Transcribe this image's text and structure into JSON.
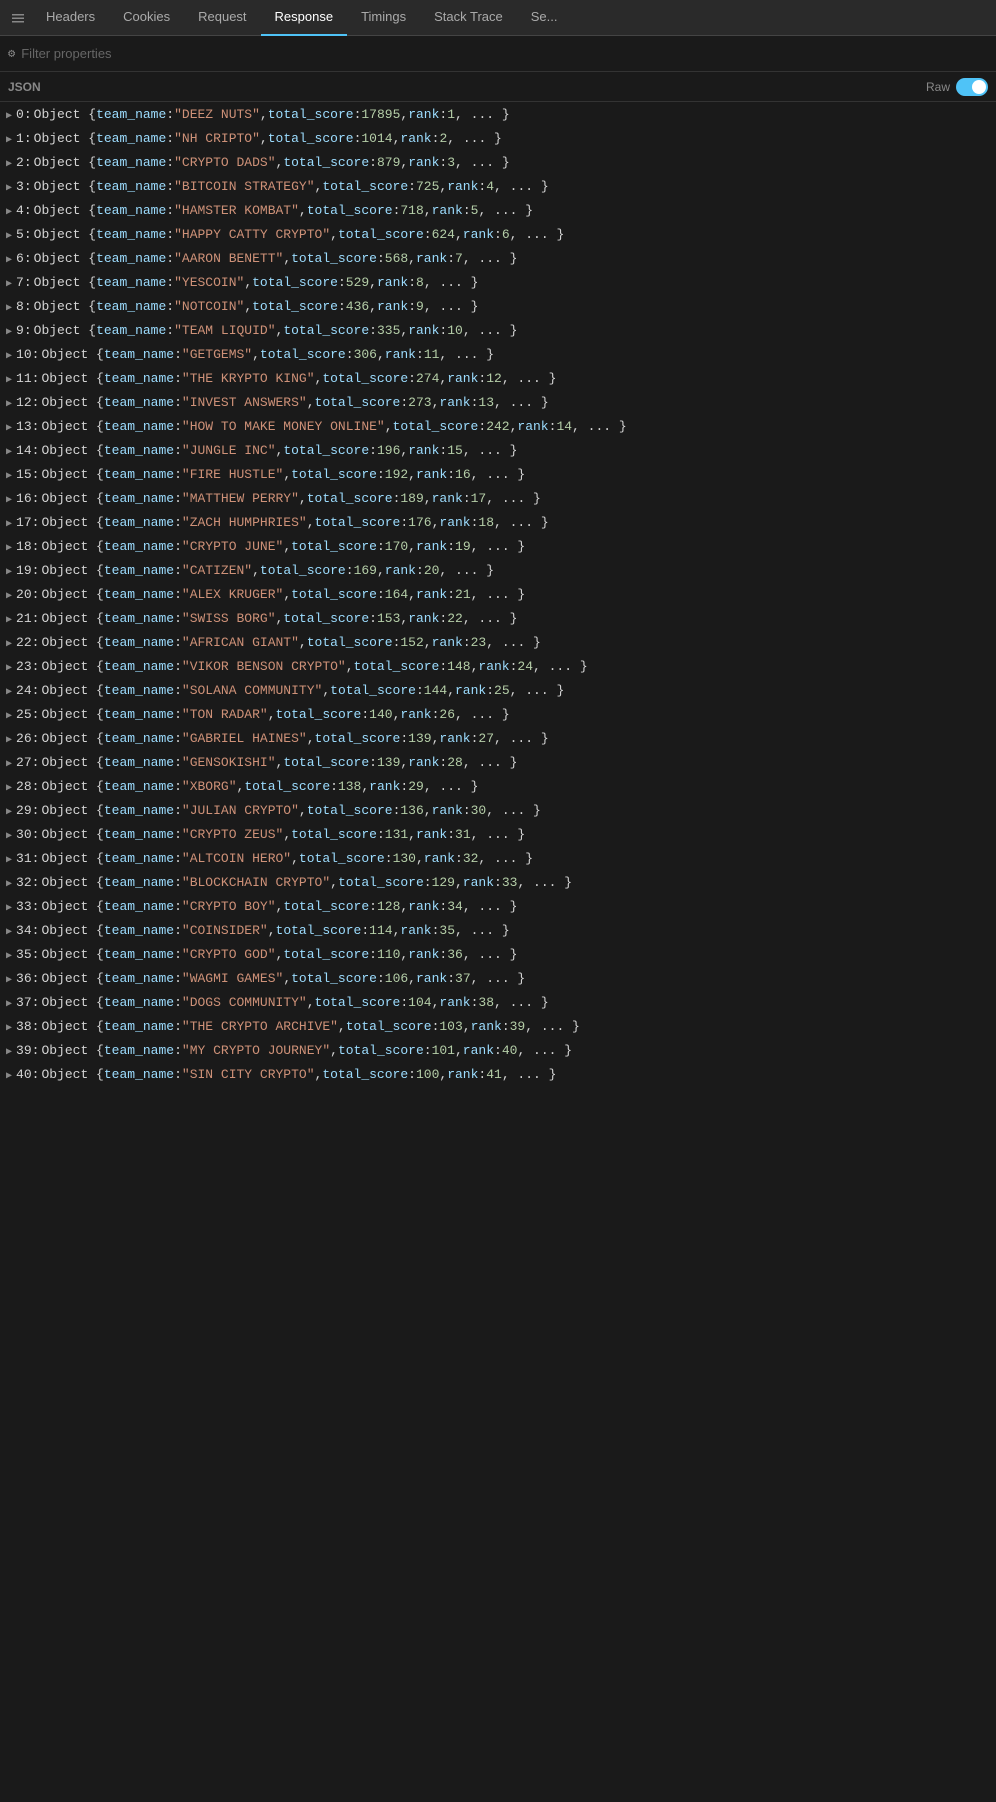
{
  "tabs": [
    {
      "label": "Headers",
      "active": false
    },
    {
      "label": "Cookies",
      "active": false
    },
    {
      "label": "Request",
      "active": false
    },
    {
      "label": "Response",
      "active": true
    },
    {
      "label": "Timings",
      "active": false
    },
    {
      "label": "Stack Trace",
      "active": false
    },
    {
      "label": "Se...",
      "active": false
    }
  ],
  "filter": {
    "placeholder": "Filter properties"
  },
  "json_label": "JSON",
  "raw_label": "Raw",
  "raw_on": true,
  "rows": [
    {
      "index": 0,
      "team_name": "DEEZ NUTS",
      "total_score": 17895,
      "rank": 1
    },
    {
      "index": 1,
      "team_name": "NH CRIPTO",
      "total_score": 1014,
      "rank": 2
    },
    {
      "index": 2,
      "team_name": "CRYPTO DADS",
      "total_score": 879,
      "rank": 3
    },
    {
      "index": 3,
      "team_name": "BITCOIN STRATEGY",
      "total_score": 725,
      "rank": 4
    },
    {
      "index": 4,
      "team_name": "HAMSTER KOMBAT",
      "total_score": 718,
      "rank": 5
    },
    {
      "index": 5,
      "team_name": "HAPPY CATTY CRYPTO",
      "total_score": 624,
      "rank": 6
    },
    {
      "index": 6,
      "team_name": "AARON BENETT",
      "total_score": 568,
      "rank": 7
    },
    {
      "index": 7,
      "team_name": "YESCOIN",
      "total_score": 529,
      "rank": 8
    },
    {
      "index": 8,
      "team_name": "NOTCOIN",
      "total_score": 436,
      "rank": 9
    },
    {
      "index": 9,
      "team_name": "TEAM LIQUID",
      "total_score": 335,
      "rank": 10
    },
    {
      "index": 10,
      "team_name": "GETGEMS",
      "total_score": 306,
      "rank": 11
    },
    {
      "index": 11,
      "team_name": "THE KRYPTO KING",
      "total_score": 274,
      "rank": 12
    },
    {
      "index": 12,
      "team_name": "INVEST ANSWERS",
      "total_score": 273,
      "rank": 13
    },
    {
      "index": 13,
      "team_name": "HOW TO MAKE MONEY ONLINE",
      "total_score": 242,
      "rank": 14
    },
    {
      "index": 14,
      "team_name": "JUNGLE INC",
      "total_score": 196,
      "rank": 15
    },
    {
      "index": 15,
      "team_name": "FIRE HUSTLE",
      "total_score": 192,
      "rank": 16
    },
    {
      "index": 16,
      "team_name": "MATTHEW PERRY",
      "total_score": 189,
      "rank": 17
    },
    {
      "index": 17,
      "team_name": "ZACH HUMPHRIES",
      "total_score": 176,
      "rank": 18
    },
    {
      "index": 18,
      "team_name": "CRYPTO JUNE",
      "total_score": 170,
      "rank": 19
    },
    {
      "index": 19,
      "team_name": "CATIZEN",
      "total_score": 169,
      "rank": 20
    },
    {
      "index": 20,
      "team_name": "ALEX KRUGER",
      "total_score": 164,
      "rank": 21
    },
    {
      "index": 21,
      "team_name": "SWISS BORG",
      "total_score": 153,
      "rank": 22
    },
    {
      "index": 22,
      "team_name": "AFRICAN GIANT",
      "total_score": 152,
      "rank": 23
    },
    {
      "index": 23,
      "team_name": "VIKOR BENSON CRYPTO",
      "total_score": 148,
      "rank": 24
    },
    {
      "index": 24,
      "team_name": "SOLANA COMMUNITY",
      "total_score": 144,
      "rank": 25
    },
    {
      "index": 25,
      "team_name": "TON RADAR",
      "total_score": 140,
      "rank": 26
    },
    {
      "index": 26,
      "team_name": "GABRIEL HAINES",
      "total_score": 139,
      "rank": 27
    },
    {
      "index": 27,
      "team_name": "GENSOKISHI",
      "total_score": 139,
      "rank": 28
    },
    {
      "index": 28,
      "team_name": "XBORG",
      "total_score": 138,
      "rank": 29
    },
    {
      "index": 29,
      "team_name": "JULIAN CRYPTO",
      "total_score": 136,
      "rank": 30
    },
    {
      "index": 30,
      "team_name": "CRYPTO ZEUS",
      "total_score": 131,
      "rank": 31
    },
    {
      "index": 31,
      "team_name": "ALTCOIN HERO",
      "total_score": 130,
      "rank": 32
    },
    {
      "index": 32,
      "team_name": "BLOCKCHAIN CRYPTO",
      "total_score": 129,
      "rank": 33
    },
    {
      "index": 33,
      "team_name": "CRYPTO BOY",
      "total_score": 128,
      "rank": 34
    },
    {
      "index": 34,
      "team_name": "COINSIDER",
      "total_score": 114,
      "rank": 35
    },
    {
      "index": 35,
      "team_name": "CRYPTO GOD",
      "total_score": 110,
      "rank": 36
    },
    {
      "index": 36,
      "team_name": "WAGMI GAMES",
      "total_score": 106,
      "rank": 37
    },
    {
      "index": 37,
      "team_name": "DOGS COMMUNITY",
      "total_score": 104,
      "rank": 38
    },
    {
      "index": 38,
      "team_name": "THE CRYPTO ARCHIVE",
      "total_score": 103,
      "rank": 39
    },
    {
      "index": 39,
      "team_name": "MY CRYPTO JOURNEY",
      "total_score": 101,
      "rank": 40
    },
    {
      "index": 40,
      "team_name": "SIN CITY CRYPTO",
      "total_score": 100,
      "rank": 41
    }
  ]
}
